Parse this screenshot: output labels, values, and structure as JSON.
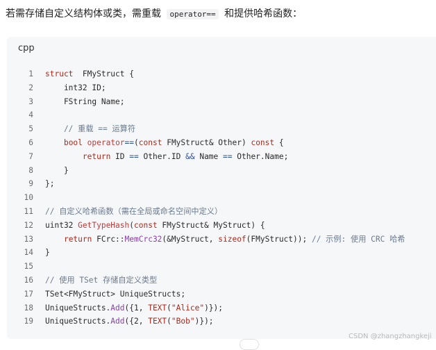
{
  "intro": {
    "prefix": "若需存储自定义结构体或类，需重载",
    "code": "operator==",
    "suffix": "和提供哈希函数："
  },
  "code_block": {
    "language": "cpp",
    "lines": [
      {
        "n": "1",
        "parts": [
          [
            "kw",
            "struct"
          ],
          [
            "",
            "  FMyStruct {"
          ]
        ]
      },
      {
        "n": "2",
        "parts": [
          [
            "",
            "    int32 ID;"
          ]
        ]
      },
      {
        "n": "3",
        "parts": [
          [
            "",
            "    FString Name;"
          ]
        ]
      },
      {
        "n": "4",
        "parts": []
      },
      {
        "n": "5",
        "parts": [
          [
            "cm",
            "    // 重载 == 运算符"
          ]
        ]
      },
      {
        "n": "6",
        "parts": [
          [
            "",
            "    "
          ],
          [
            "kw",
            "bool"
          ],
          [
            "",
            " "
          ],
          [
            "fn",
            "operator"
          ],
          [
            "op",
            "=="
          ],
          [
            "",
            "("
          ],
          [
            "kw",
            "const"
          ],
          [
            "",
            " FMyStruct& Other) "
          ],
          [
            "kw",
            "const"
          ],
          [
            "",
            " {"
          ]
        ]
      },
      {
        "n": "7",
        "parts": [
          [
            "",
            "        "
          ],
          [
            "kw",
            "return"
          ],
          [
            "",
            " ID "
          ],
          [
            "op",
            "=="
          ],
          [
            "",
            " Other.ID "
          ],
          [
            "op",
            "&&"
          ],
          [
            "",
            " Name "
          ],
          [
            "op",
            "=="
          ],
          [
            "",
            " Other.Name;"
          ]
        ]
      },
      {
        "n": "8",
        "parts": [
          [
            "",
            "    }"
          ]
        ]
      },
      {
        "n": "9",
        "parts": [
          [
            "",
            "};"
          ]
        ]
      },
      {
        "n": "10",
        "parts": []
      },
      {
        "n": "11",
        "parts": [
          [
            "cm",
            "// 自定义哈希函数（需在全局或命名空间中定义）"
          ]
        ]
      },
      {
        "n": "12",
        "parts": [
          [
            "",
            "uint32 "
          ],
          [
            "fn",
            "GetTypeHash"
          ],
          [
            "",
            "("
          ],
          [
            "kw",
            "const"
          ],
          [
            "",
            " FMyStruct& MyStruct) {"
          ]
        ]
      },
      {
        "n": "13",
        "parts": [
          [
            "",
            "    "
          ],
          [
            "kw",
            "return"
          ],
          [
            "",
            " FCrc::"
          ],
          [
            "mg",
            "MemCrc32"
          ],
          [
            "",
            "(&MyStruct, "
          ],
          [
            "kw",
            "sizeof"
          ],
          [
            "",
            "(FMyStruct)); "
          ],
          [
            "cm",
            "// 示例: 使用 CRC 哈希"
          ]
        ]
      },
      {
        "n": "14",
        "parts": [
          [
            "",
            "}"
          ]
        ]
      },
      {
        "n": "15",
        "parts": []
      },
      {
        "n": "16",
        "parts": [
          [
            "cm",
            "// 使用 TSet 存储自定义类型"
          ]
        ]
      },
      {
        "n": "17",
        "parts": [
          [
            "",
            "TSet<FMyStruct> UniqueStructs;"
          ]
        ]
      },
      {
        "n": "18",
        "parts": [
          [
            "",
            "UniqueStructs."
          ],
          [
            "mg",
            "Add"
          ],
          [
            "",
            "({1, "
          ],
          [
            "kw",
            "TEXT"
          ],
          [
            "",
            "("
          ],
          [
            "str",
            "\"Alice\""
          ],
          [
            "",
            ")});"
          ]
        ]
      },
      {
        "n": "19",
        "parts": [
          [
            "",
            "UniqueStructs."
          ],
          [
            "mg",
            "Add"
          ],
          [
            "",
            "({2, "
          ],
          [
            "kw",
            "TEXT"
          ],
          [
            "",
            "("
          ],
          [
            "str",
            "\"Bob\""
          ],
          [
            "",
            ")});"
          ]
        ]
      }
    ]
  },
  "watermark": "CSDN @zhangzhangkeji",
  "colors": {
    "keyword": "#b0281a",
    "function": "#c23a3a",
    "member": "#8a3db6",
    "comment": "#6a7a8c",
    "operator": "#2f4fa6",
    "code_bg": "#f6f7f9"
  }
}
